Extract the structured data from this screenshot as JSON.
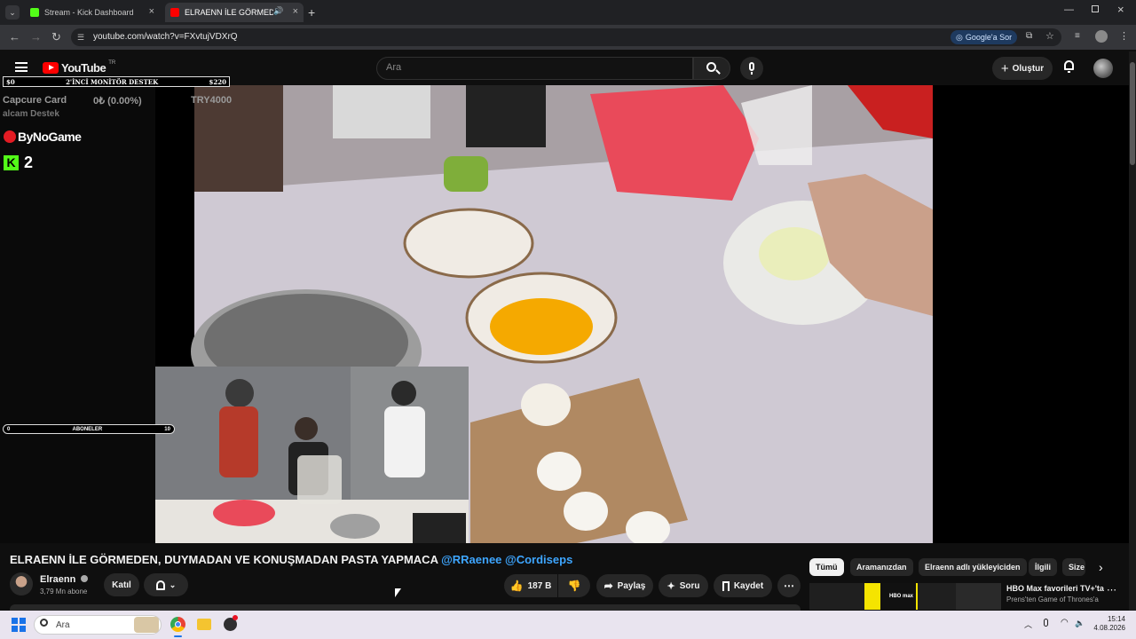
{
  "browser": {
    "tabs": [
      {
        "label": "Stream - Kick Dashboard",
        "active": false
      },
      {
        "label": "ELRAENN İLE GÖRMEDEN, ",
        "active": true
      }
    ],
    "url": "youtube.com/watch?v=FXvtujVDXrQ",
    "google_sor": "Google'a Sor"
  },
  "youtube": {
    "logo_text": "YouTube",
    "region": "TR",
    "search_placeholder": "Ara",
    "create_label": "Oluştur"
  },
  "overlay": {
    "goal_left": "$0",
    "goal_title": "2'İNCİ MONİTÖR DESTEK",
    "goal_right": "$220",
    "capcure_label": "Capcure Card",
    "capcure_value": "0₺ (0.00%)",
    "capcure_target": "TRY4000",
    "alcam": "alcam Destek",
    "brand": "ByNoGame",
    "kick_count": "2",
    "subs_left": "0",
    "subs_label": "ABONELER",
    "subs_right": "10"
  },
  "video": {
    "title_main": "ELRAENN İLE GÖRMEDEN, DUYMADAN VE KONUŞMADAN PASTA YAPMACA ",
    "title_tag1": "@RRaenee",
    "title_tag2": "@Cordiseps",
    "channel": "Elraenn",
    "subscribers": "3,79 Mn abone",
    "join_label": "Katıl",
    "likes": "187 B",
    "share_label": "Paylaş",
    "ask_label": "Soru",
    "save_label": "Kaydet"
  },
  "chips": [
    "Tümü",
    "Aramanızdan",
    "Elraenn adlı yükleyiciden",
    "İlgili",
    "Size"
  ],
  "recommendation": {
    "title": "HBO Max favorileri TV+'ta",
    "subtitle": "Prens'ten Game of Thrones'a",
    "thumb_text": "HBO max"
  },
  "taskbar": {
    "search_placeholder": "Ara",
    "time": "15:14",
    "date": "4.08.2026"
  }
}
